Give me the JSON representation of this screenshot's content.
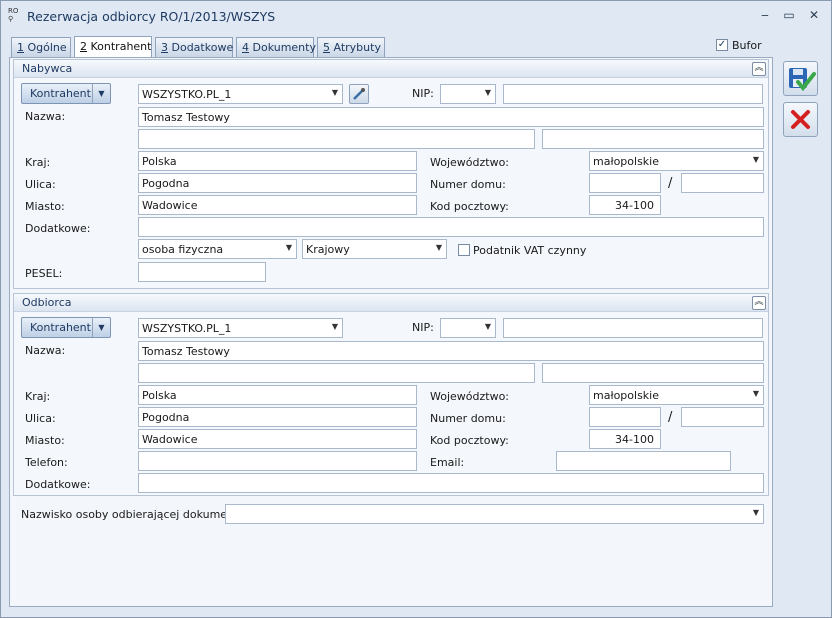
{
  "window": {
    "title": "Rezerwacja odbiorcy RO/1/2013/WSZYS",
    "icon_text": "RO"
  },
  "window_controls": {
    "minimize": "‒",
    "maximize": "▭",
    "close": "✕"
  },
  "tabs": [
    {
      "num": "1",
      "label": "Ogólne"
    },
    {
      "num": "2",
      "label": "Kontrahent"
    },
    {
      "num": "3",
      "label": "Dodatkowe"
    },
    {
      "num": "4",
      "label": "Dokumenty"
    },
    {
      "num": "5",
      "label": "Atrybuty"
    }
  ],
  "bufor": {
    "label": "Bufor",
    "checked": true
  },
  "nabywca": {
    "title": "Nabywca",
    "kontrahent_button": "Kontrahent",
    "code": "WSZYSTKO.PL_1",
    "nip_label": "NIP:",
    "nip_prefix": "",
    "nip": "",
    "nazwa_label": "Nazwa:",
    "nazwa": "Tomasz Testowy",
    "nazwa2": "",
    "nazwa3": "",
    "kraj_label": "Kraj:",
    "kraj": "Polska",
    "wojewodztwo_label": "Województwo:",
    "wojewodztwo": "małopolskie",
    "ulica_label": "Ulica:",
    "ulica": "Pogodna",
    "numer_domu_label": "Numer domu:",
    "numer_domu": "",
    "numer_lokalu": "",
    "slash": "/",
    "miasto_label": "Miasto:",
    "miasto": "Wadowice",
    "kod_label": "Kod pocztowy:",
    "kod": "34-100",
    "dodatkowe_label": "Dodatkowe:",
    "dodatkowe": "",
    "status": "osoba fizyczna",
    "rodzaj": "Krajowy",
    "vat_label": "Podatnik VAT czynny",
    "vat_checked": false,
    "pesel_label": "PESEL:",
    "pesel": ""
  },
  "odbiorca": {
    "title": "Odbiorca",
    "kontrahent_button": "Kontrahent",
    "code": "WSZYSTKO.PL_1",
    "nip_label": "NIP:",
    "nip_prefix": "",
    "nip": "",
    "nazwa_label": "Nazwa:",
    "nazwa": "Tomasz Testowy",
    "nazwa2": "",
    "nazwa3": "",
    "kraj_label": "Kraj:",
    "kraj": "Polska",
    "wojewodztwo_label": "Województwo:",
    "wojewodztwo": "małopolskie",
    "ulica_label": "Ulica:",
    "ulica": "Pogodna",
    "numer_domu_label": "Numer domu:",
    "numer_domu": "",
    "numer_lokalu": "",
    "slash": "/",
    "miasto_label": "Miasto:",
    "miasto": "Wadowice",
    "kod_label": "Kod pocztowy:",
    "kod": "34-100",
    "telefon_label": "Telefon:",
    "telefon": "",
    "email_label": "Email:",
    "email": "",
    "dodatkowe_label": "Dodatkowe:",
    "dodatkowe": ""
  },
  "nazwisko": {
    "label": "Nazwisko osoby odbierającej dokument:",
    "value": ""
  },
  "icons": {
    "collapse": "chevrons-up-icon",
    "dropdown": "chevron-down-icon",
    "save": "save-icon",
    "cancel": "cancel-icon",
    "picker": "pipette-icon"
  },
  "colors": {
    "accent": "#1f3b63",
    "save_check": "#3aa84a",
    "cancel": "#d42020"
  }
}
